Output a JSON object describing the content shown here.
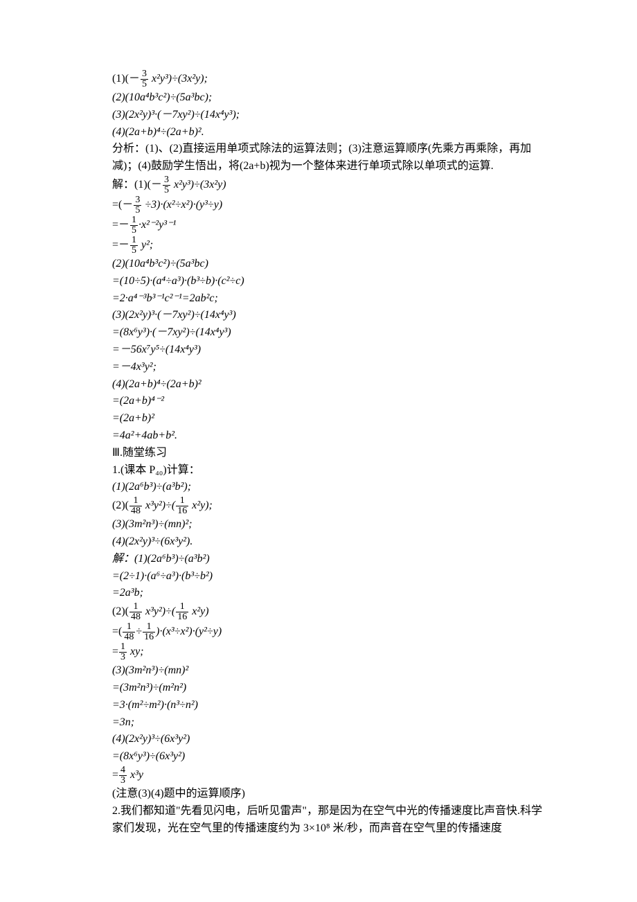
{
  "p01": "(1)(－",
  "f01n": "3",
  "f01d": "5",
  "p01b": " x²y³)÷(3x²y);",
  "p02": "(2)(10a⁴b³c²)÷(5a³bc);",
  "p03": "(3)(2x²y)³·(－7xy²)÷(14x⁴y³);",
  "p04": "(4)(2a+b)⁴÷(2a+b)².",
  "p05": "分析：(1)、(2)直接运用单项式除法的运算法则；(3)注意运算顺序(先乘方再乘除，再加减)；(4)鼓励学生悟出，将(2a+b)视为一个整体来进行单项式除以单项式的运算.",
  "p06": "解：(1)(－",
  "f02n": "3",
  "f02d": "5",
  "p06b": " x²y³)÷(3x²y)",
  "p07": "=(－",
  "f03n": "3",
  "f03d": "5",
  "p07b": " ÷3)·(x²÷x²)·(y³÷y)",
  "p08": "=－",
  "f04n": "1",
  "f04d": "5",
  "p08b": "·x²⁻²y³⁻¹",
  "p09": "=－",
  "f05n": "1",
  "f05d": "5",
  "p09b": " y²;",
  "p10": "(2)(10a⁴b³c²)÷(5a³bc)",
  "p11": "=(10÷5)·(a⁴÷a³)·(b³÷b)·(c²÷c)",
  "p12": "=2·a⁴⁻³b³⁻¹c²⁻¹=2ab²c;",
  "p13": "(3)(2x²y)³·(－7xy²)÷(14x⁴y³)",
  "p14": "=(8x⁶y³)·(－7xy²)÷(14x⁴y³)",
  "p15": "=－56x⁷y⁵÷(14x⁴y³)",
  "p16": "=－4x³y²;",
  "p17": "(4)(2a+b)⁴÷(2a+b)²",
  "p18": "=(2a+b)⁴⁻²",
  "p19": "=(2a+b)²",
  "p20": "=4a²+4ab+b².",
  "p21": "Ⅲ.随堂练习",
  "p22": "1.(课本 P₄₀)计算：",
  "p23": "(1)(2a⁶b³)÷(a³b²);",
  "p24": "(2)(",
  "f06n": "1",
  "f06d": "48",
  "p24b": " x³y²)÷(",
  "f07n": "1",
  "f07d": "16",
  "p24c": " x²y);",
  "p25": "(3)(3m²n³)÷(mn)²;",
  "p26": "(4)(2x²y)³÷(6x³y²).",
  "p27": "解：(1)(2a⁶b³)÷(a³b²)",
  "p28": "=(2÷1)·(a⁶÷a³)·(b³÷b²)",
  "p29": "=2a³b;",
  "p30": "(2)(",
  "f08n": "1",
  "f08d": "48",
  "p30b": " x³y²)÷(",
  "f09n": "1",
  "f09d": "16",
  "p30c": " x²y)",
  "p31": "=(",
  "f10n": "1",
  "f10d": "48",
  "p31b": "÷",
  "f11n": "1",
  "f11d": "16",
  "p31c": ")·(x³÷x²)·(y²÷y)",
  "p32": "=",
  "f12n": "1",
  "f12d": "3",
  "p32b": " xy;",
  "p33": "(3)(3m²n³)÷(mn)²",
  "p34": "=(3m²n³)÷(m²n²)",
  "p35": "=3·(m²÷m²)·(n³÷n²)",
  "p36": "=3n;",
  "p37": "(4)(2x²y)³÷(6x³y²)",
  "p38": "=(8x⁶y³)÷(6x³y²)",
  "p39": "=",
  "f13n": "4",
  "f13d": "3",
  "p39b": " x³y",
  "p40": "(注意(3)(4)题中的运算顺序)",
  "p41": "2.我们都知道\"先看见闪电，后听见雷声\"，那是因为在空气中光的传播速度比声音快.科学家们发现，光在空气里的传播速度约为 3×10⁸ 米/秒，而声音在空气里的传播速度"
}
